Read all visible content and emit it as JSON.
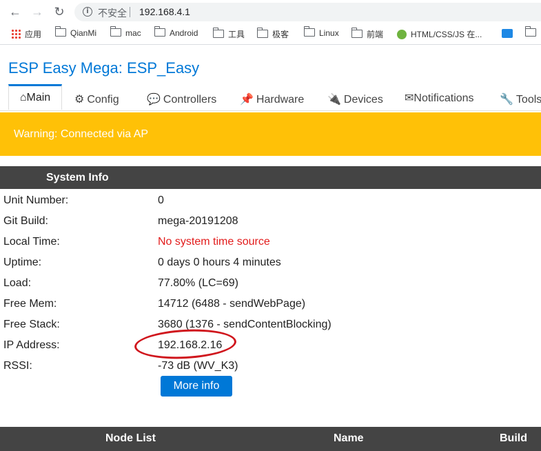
{
  "browser": {
    "back": "←",
    "forward": "→",
    "reload": "↻",
    "info_icon": "i",
    "security_label": "不安全",
    "url": "192.168.4.1",
    "bookmarks": [
      {
        "label": "应用",
        "icon": "apps-grid-icon"
      },
      {
        "label": "QianMi",
        "icon": "folder-icon"
      },
      {
        "label": "mac",
        "icon": "folder-icon"
      },
      {
        "label": "Android",
        "icon": "folder-icon"
      },
      {
        "label": "工具",
        "icon": "folder-icon"
      },
      {
        "label": "极客",
        "icon": "folder-icon"
      },
      {
        "label": "Linux",
        "icon": "folder-icon"
      },
      {
        "label": "前端",
        "icon": "folder-icon"
      },
      {
        "label": "HTML/CSS/JS 在...",
        "icon": "html-extension-icon"
      }
    ]
  },
  "page": {
    "title": "ESP Easy Mega: ESP_Easy",
    "tabs": [
      {
        "icon": "⌂",
        "label": "Main"
      },
      {
        "icon": "⚙",
        "label": "Config"
      },
      {
        "icon": "💬",
        "label": "Controllers"
      },
      {
        "icon": "📌",
        "label": "Hardware"
      },
      {
        "icon": "🔌",
        "label": "Devices"
      },
      {
        "icon": "✉",
        "label": "Notifications"
      },
      {
        "icon": "🔧",
        "label": "Tools"
      }
    ],
    "warning": "Warning: Connected via AP",
    "system_info": {
      "header": "System Info",
      "rows": [
        {
          "label": "Unit Number:",
          "value": "0"
        },
        {
          "label": "Git Build:",
          "value": "mega-20191208"
        },
        {
          "label": "Local Time:",
          "value": "No system time source"
        },
        {
          "label": "Uptime:",
          "value": "0 days 0 hours 4 minutes"
        },
        {
          "label": "Load:",
          "value": "77.80% (LC=69)"
        },
        {
          "label": "Free Mem:",
          "value": "14712 (6488 - sendWebPage)"
        },
        {
          "label": "Free Stack:",
          "value": "3680 (1376 - sendContentBlocking)"
        },
        {
          "label": "IP Address:",
          "value": "192.168.2.16"
        },
        {
          "label": "RSSI:",
          "value": "-73 dB (WV_K3)"
        }
      ],
      "more_info": "More info"
    },
    "node_list": {
      "columns": [
        "Node List",
        "Name",
        "Build"
      ]
    }
  },
  "colors": {
    "accent": "#0078d7",
    "warning": "#ffc107",
    "header_bg": "#444444",
    "error_text": "#e21b1b",
    "annotation": "#d0161d"
  }
}
